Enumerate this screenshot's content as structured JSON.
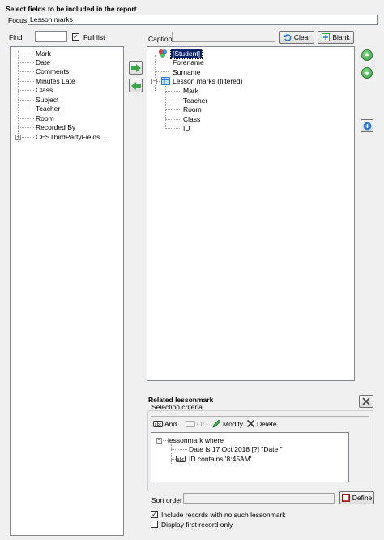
{
  "header": {
    "title": "Select fields to be included in the report",
    "focus_label": "Focus",
    "focus_value": "Lesson marks"
  },
  "find": {
    "label": "Find",
    "value": "",
    "full_list_label": "Full list",
    "full_list_checked": true
  },
  "caption": {
    "label": "Caption",
    "value": "",
    "clear_label": "Clear",
    "blank_label": "Blank"
  },
  "left_list": {
    "items": [
      "Mark",
      "Date",
      "Comments",
      "Minutes Late",
      "Class",
      "Subject",
      "Teacher",
      "Room",
      "Recorded By",
      "CESThirdPartyFields..."
    ]
  },
  "right_tree": {
    "root": "[Student]",
    "children": [
      "Forename",
      "Surname"
    ],
    "group": "Lesson marks (filtered)",
    "group_children": [
      "Mark",
      "Teacher",
      "Room",
      "Class",
      "ID"
    ]
  },
  "related": {
    "title": "Related lessonmark",
    "selection_label": "Selection criteria",
    "and_label": "And...",
    "or_label": "Or...",
    "modify_label": "Modify",
    "delete_label": "Delete",
    "criteria_root": "lessonmark where",
    "criteria_items": [
      "Date is 17 Oct 2018 [?] \"Date \"",
      "ID contains '8:45AM'"
    ],
    "sort_order_label": "Sort order",
    "sort_order_value": "",
    "define_label": "Define",
    "include_label": "Include records with no such lessonmark",
    "include_checked": true,
    "first_record_label": "Display first record only",
    "first_record_checked": false
  },
  "colors": {
    "accent_green": "#3aa64a",
    "accent_blue": "#2e7dd1",
    "selection": "#0a246a"
  }
}
